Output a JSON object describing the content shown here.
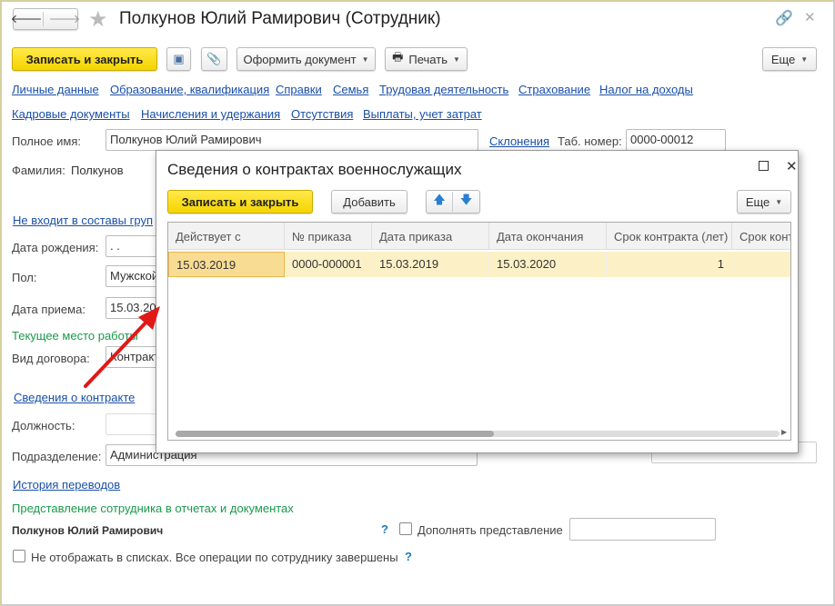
{
  "window": {
    "title": "Полкунов Юлий Рамирович (Сотрудник)"
  },
  "toolbar": {
    "save_close": "Записать и закрыть",
    "format_doc": "Оформить документ",
    "print": "Печать",
    "more": "Еще"
  },
  "nav_links": [
    "Личные данные",
    "Образование, квалификация",
    "Справки",
    "Семья",
    "Трудовая деятельность",
    "Страхование",
    "Налог на доходы",
    "Кадровые документы",
    "Начисления и удержания",
    "Отсутствия",
    "Выплаты, учет затрат"
  ],
  "form": {
    "full_name_label": "Полное имя:",
    "full_name": "Полкунов Юлий Рамирович",
    "declensions": "Склонения",
    "tab_label": "Таб. номер:",
    "tab_number": "0000-00012",
    "surname_label": "Фамилия:",
    "surname": "Полкунов",
    "groups_link": "Не входит в составы груп",
    "birth_label": "Дата рождения:",
    "birth": " .  .",
    "gender_label": "Пол:",
    "gender": "Мужской",
    "hire_label": "Дата приема:",
    "hire": "15.03.20",
    "current_work": "Текущее место работы",
    "contract_type_label": "Вид договора:",
    "contract_type": "Контракт",
    "contract_link": "Сведения о контракте",
    "position_label": "Должность:",
    "dept_label": "Подразделение:",
    "dept": "Администрация",
    "history_link": "История переводов",
    "repr_heading": "Представление сотрудника в отчетах и документах",
    "repr_name": "Полкунов Юлий Рамирович",
    "help": "?",
    "supplement": "Дополнять представление",
    "hide_label": "Не отображать в списках. Все операции по сотруднику завершены"
  },
  "modal": {
    "title": "Сведения о контрактах военнослужащих",
    "save_close": "Записать и закрыть",
    "add": "Добавить",
    "more": "Еще",
    "columns": [
      "Действует с",
      "№ приказа",
      "Дата приказа",
      "Дата окончания",
      "Срок контракта (лет)",
      "Срок конт"
    ],
    "rows": [
      [
        "15.03.2019",
        "0000-000001",
        "15.03.2019",
        "15.03.2020",
        "1",
        ""
      ]
    ]
  }
}
